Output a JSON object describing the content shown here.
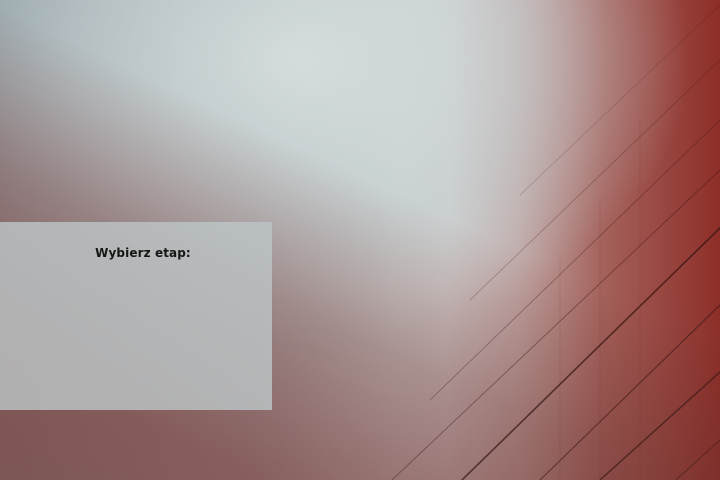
{
  "background": {
    "description_colors": {
      "sky": "#c9d0d0",
      "left_tone": "#8f9da3",
      "building_red": "#8e2e28"
    }
  },
  "stage_panel": {
    "title": "Wybierz etap:"
  },
  "colors": {
    "panel_bg": "#bcc4c6",
    "title_text": "#151515"
  }
}
